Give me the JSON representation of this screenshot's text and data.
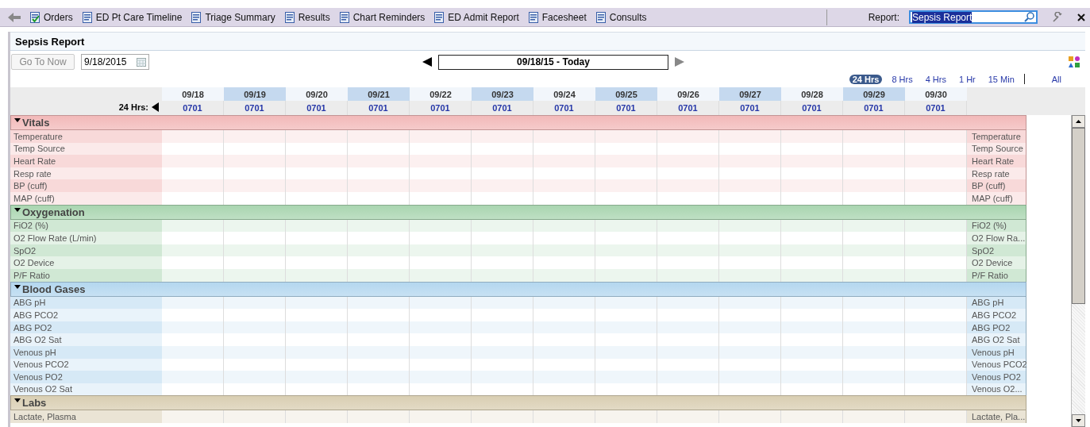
{
  "toolbar": {
    "items": [
      {
        "label": "Orders",
        "kind": "checked"
      },
      {
        "label": "ED Pt Care Timeline",
        "kind": "doc"
      },
      {
        "label": "Triage Summary",
        "kind": "doc"
      },
      {
        "label": "Results",
        "kind": "doc"
      },
      {
        "label": "Chart Reminders",
        "kind": "doc"
      },
      {
        "label": "ED Admit Report",
        "kind": "doc"
      },
      {
        "label": "Facesheet",
        "kind": "doc"
      },
      {
        "label": "Consults",
        "kind": "doc"
      }
    ],
    "report_label": "Report:",
    "report_value": "Sepsis Report"
  },
  "report": {
    "title": "Sepsis Report",
    "go_to_now": {
      "label": "Go To Now",
      "disabled": true
    },
    "date": "9/18/2015",
    "range": "09/18/15 - Today",
    "intervals": [
      {
        "label": "24 Hrs",
        "selected": true
      },
      {
        "label": "8 Hrs",
        "selected": false
      },
      {
        "label": "4 Hrs",
        "selected": false
      },
      {
        "label": "1 Hr",
        "selected": false
      },
      {
        "label": "15 Min",
        "selected": false
      }
    ],
    "all": {
      "label": "All",
      "selected": false
    }
  },
  "timeline": {
    "label": "24 Hrs:",
    "columns": [
      {
        "date": "09/18",
        "time": "0701"
      },
      {
        "date": "09/19",
        "time": "0701"
      },
      {
        "date": "09/20",
        "time": "0701"
      },
      {
        "date": "09/21",
        "time": "0701"
      },
      {
        "date": "09/22",
        "time": "0701"
      },
      {
        "date": "09/23",
        "time": "0701"
      },
      {
        "date": "09/24",
        "time": "0701"
      },
      {
        "date": "09/25",
        "time": "0701"
      },
      {
        "date": "09/26",
        "time": "0701"
      },
      {
        "date": "09/27",
        "time": "0701"
      },
      {
        "date": "09/28",
        "time": "0701"
      },
      {
        "date": "09/29",
        "time": "0701"
      },
      {
        "date": "09/30",
        "time": "0701"
      }
    ]
  },
  "sections": [
    {
      "title": "Vitals",
      "color": "#f2b9b9",
      "expanded": true,
      "rows": [
        {
          "label": "Temperature",
          "right_label": "Temperature"
        },
        {
          "label": "Temp Source",
          "right_label": "Temp Source"
        },
        {
          "label": "Heart Rate",
          "right_label": "Heart Rate"
        },
        {
          "label": "Resp rate",
          "right_label": "Resp rate"
        },
        {
          "label": "BP (cuff)",
          "right_label": "BP (cuff)"
        },
        {
          "label": "MAP (cuff)",
          "right_label": "MAP (cuff)"
        }
      ]
    },
    {
      "title": "Oxygenation",
      "color": "#a9d5b0",
      "expanded": true,
      "rows": [
        {
          "label": "FiO2 (%)",
          "right_label": "FiO2 (%)"
        },
        {
          "label": "O2 Flow Rate (L/min)",
          "right_label": "O2 Flow Ra..."
        },
        {
          "label": "SpO2",
          "right_label": "SpO2"
        },
        {
          "label": "O2 Device",
          "right_label": "O2 Device"
        },
        {
          "label": "P/F Ratio",
          "right_label": "P/F Ratio"
        }
      ]
    },
    {
      "title": "Blood Gases",
      "color": "#b4d7ef",
      "expanded": true,
      "rows": [
        {
          "label": "ABG pH",
          "right_label": "ABG pH"
        },
        {
          "label": "ABG PCO2",
          "right_label": "ABG PCO2"
        },
        {
          "label": "ABG PO2",
          "right_label": "ABG PO2"
        },
        {
          "label": "ABG O2 Sat",
          "right_label": "ABG O2 Sat"
        },
        {
          "label": "Venous pH",
          "right_label": "Venous pH"
        },
        {
          "label": "Venous PCO2",
          "right_label": "Venous PCO2"
        },
        {
          "label": "Venous PO2",
          "right_label": "Venous PO2"
        },
        {
          "label": "Venous O2 Sat",
          "right_label": "Venous O2..."
        }
      ]
    },
    {
      "title": "Labs",
      "color": "#d9ceb2",
      "expanded": true,
      "rows": [
        {
          "label": "Lactate, Plasma",
          "right_label": "Lactate, Pla..."
        }
      ]
    }
  ]
}
